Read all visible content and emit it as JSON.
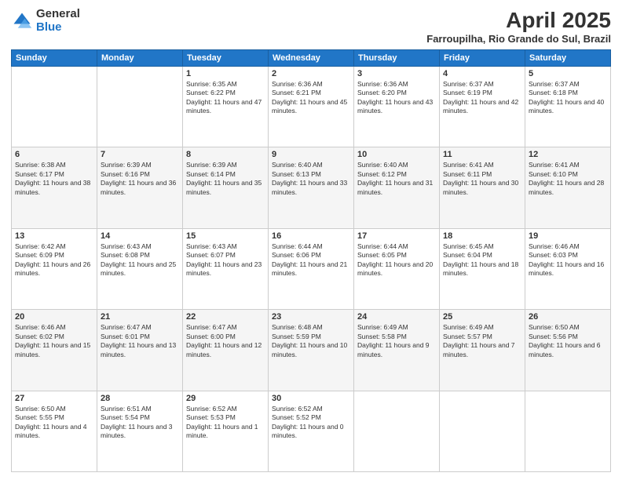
{
  "header": {
    "logo_general": "General",
    "logo_blue": "Blue",
    "title": "April 2025",
    "location": "Farroupilha, Rio Grande do Sul, Brazil"
  },
  "weekdays": [
    "Sunday",
    "Monday",
    "Tuesday",
    "Wednesday",
    "Thursday",
    "Friday",
    "Saturday"
  ],
  "weeks": [
    [
      {
        "day": "",
        "info": ""
      },
      {
        "day": "",
        "info": ""
      },
      {
        "day": "1",
        "info": "Sunrise: 6:35 AM\nSunset: 6:22 PM\nDaylight: 11 hours and 47 minutes."
      },
      {
        "day": "2",
        "info": "Sunrise: 6:36 AM\nSunset: 6:21 PM\nDaylight: 11 hours and 45 minutes."
      },
      {
        "day": "3",
        "info": "Sunrise: 6:36 AM\nSunset: 6:20 PM\nDaylight: 11 hours and 43 minutes."
      },
      {
        "day": "4",
        "info": "Sunrise: 6:37 AM\nSunset: 6:19 PM\nDaylight: 11 hours and 42 minutes."
      },
      {
        "day": "5",
        "info": "Sunrise: 6:37 AM\nSunset: 6:18 PM\nDaylight: 11 hours and 40 minutes."
      }
    ],
    [
      {
        "day": "6",
        "info": "Sunrise: 6:38 AM\nSunset: 6:17 PM\nDaylight: 11 hours and 38 minutes."
      },
      {
        "day": "7",
        "info": "Sunrise: 6:39 AM\nSunset: 6:16 PM\nDaylight: 11 hours and 36 minutes."
      },
      {
        "day": "8",
        "info": "Sunrise: 6:39 AM\nSunset: 6:14 PM\nDaylight: 11 hours and 35 minutes."
      },
      {
        "day": "9",
        "info": "Sunrise: 6:40 AM\nSunset: 6:13 PM\nDaylight: 11 hours and 33 minutes."
      },
      {
        "day": "10",
        "info": "Sunrise: 6:40 AM\nSunset: 6:12 PM\nDaylight: 11 hours and 31 minutes."
      },
      {
        "day": "11",
        "info": "Sunrise: 6:41 AM\nSunset: 6:11 PM\nDaylight: 11 hours and 30 minutes."
      },
      {
        "day": "12",
        "info": "Sunrise: 6:41 AM\nSunset: 6:10 PM\nDaylight: 11 hours and 28 minutes."
      }
    ],
    [
      {
        "day": "13",
        "info": "Sunrise: 6:42 AM\nSunset: 6:09 PM\nDaylight: 11 hours and 26 minutes."
      },
      {
        "day": "14",
        "info": "Sunrise: 6:43 AM\nSunset: 6:08 PM\nDaylight: 11 hours and 25 minutes."
      },
      {
        "day": "15",
        "info": "Sunrise: 6:43 AM\nSunset: 6:07 PM\nDaylight: 11 hours and 23 minutes."
      },
      {
        "day": "16",
        "info": "Sunrise: 6:44 AM\nSunset: 6:06 PM\nDaylight: 11 hours and 21 minutes."
      },
      {
        "day": "17",
        "info": "Sunrise: 6:44 AM\nSunset: 6:05 PM\nDaylight: 11 hours and 20 minutes."
      },
      {
        "day": "18",
        "info": "Sunrise: 6:45 AM\nSunset: 6:04 PM\nDaylight: 11 hours and 18 minutes."
      },
      {
        "day": "19",
        "info": "Sunrise: 6:46 AM\nSunset: 6:03 PM\nDaylight: 11 hours and 16 minutes."
      }
    ],
    [
      {
        "day": "20",
        "info": "Sunrise: 6:46 AM\nSunset: 6:02 PM\nDaylight: 11 hours and 15 minutes."
      },
      {
        "day": "21",
        "info": "Sunrise: 6:47 AM\nSunset: 6:01 PM\nDaylight: 11 hours and 13 minutes."
      },
      {
        "day": "22",
        "info": "Sunrise: 6:47 AM\nSunset: 6:00 PM\nDaylight: 11 hours and 12 minutes."
      },
      {
        "day": "23",
        "info": "Sunrise: 6:48 AM\nSunset: 5:59 PM\nDaylight: 11 hours and 10 minutes."
      },
      {
        "day": "24",
        "info": "Sunrise: 6:49 AM\nSunset: 5:58 PM\nDaylight: 11 hours and 9 minutes."
      },
      {
        "day": "25",
        "info": "Sunrise: 6:49 AM\nSunset: 5:57 PM\nDaylight: 11 hours and 7 minutes."
      },
      {
        "day": "26",
        "info": "Sunrise: 6:50 AM\nSunset: 5:56 PM\nDaylight: 11 hours and 6 minutes."
      }
    ],
    [
      {
        "day": "27",
        "info": "Sunrise: 6:50 AM\nSunset: 5:55 PM\nDaylight: 11 hours and 4 minutes."
      },
      {
        "day": "28",
        "info": "Sunrise: 6:51 AM\nSunset: 5:54 PM\nDaylight: 11 hours and 3 minutes."
      },
      {
        "day": "29",
        "info": "Sunrise: 6:52 AM\nSunset: 5:53 PM\nDaylight: 11 hours and 1 minute."
      },
      {
        "day": "30",
        "info": "Sunrise: 6:52 AM\nSunset: 5:52 PM\nDaylight: 11 hours and 0 minutes."
      },
      {
        "day": "",
        "info": ""
      },
      {
        "day": "",
        "info": ""
      },
      {
        "day": "",
        "info": ""
      }
    ]
  ]
}
